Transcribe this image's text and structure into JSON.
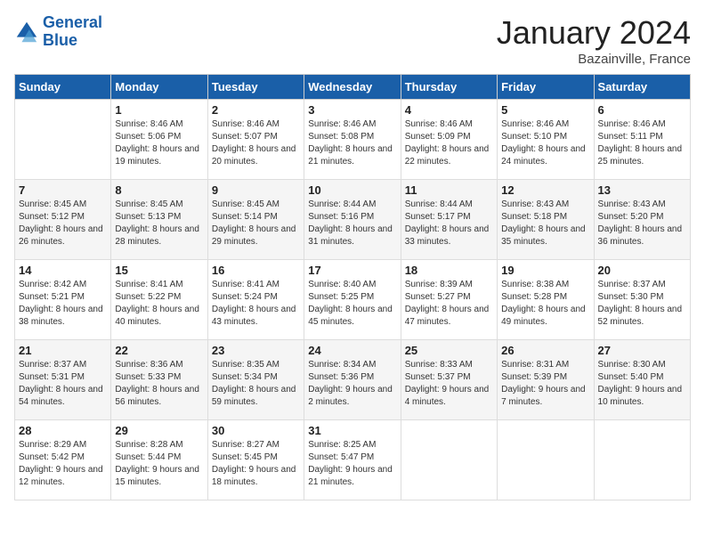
{
  "header": {
    "logo_line1": "General",
    "logo_line2": "Blue",
    "month": "January 2024",
    "location": "Bazainville, France"
  },
  "days_of_week": [
    "Sunday",
    "Monday",
    "Tuesday",
    "Wednesday",
    "Thursday",
    "Friday",
    "Saturday"
  ],
  "weeks": [
    [
      {
        "day": "",
        "sunrise": "",
        "sunset": "",
        "daylight": ""
      },
      {
        "day": "1",
        "sunrise": "Sunrise: 8:46 AM",
        "sunset": "Sunset: 5:06 PM",
        "daylight": "Daylight: 8 hours and 19 minutes."
      },
      {
        "day": "2",
        "sunrise": "Sunrise: 8:46 AM",
        "sunset": "Sunset: 5:07 PM",
        "daylight": "Daylight: 8 hours and 20 minutes."
      },
      {
        "day": "3",
        "sunrise": "Sunrise: 8:46 AM",
        "sunset": "Sunset: 5:08 PM",
        "daylight": "Daylight: 8 hours and 21 minutes."
      },
      {
        "day": "4",
        "sunrise": "Sunrise: 8:46 AM",
        "sunset": "Sunset: 5:09 PM",
        "daylight": "Daylight: 8 hours and 22 minutes."
      },
      {
        "day": "5",
        "sunrise": "Sunrise: 8:46 AM",
        "sunset": "Sunset: 5:10 PM",
        "daylight": "Daylight: 8 hours and 24 minutes."
      },
      {
        "day": "6",
        "sunrise": "Sunrise: 8:46 AM",
        "sunset": "Sunset: 5:11 PM",
        "daylight": "Daylight: 8 hours and 25 minutes."
      }
    ],
    [
      {
        "day": "7",
        "sunrise": "Sunrise: 8:45 AM",
        "sunset": "Sunset: 5:12 PM",
        "daylight": "Daylight: 8 hours and 26 minutes."
      },
      {
        "day": "8",
        "sunrise": "Sunrise: 8:45 AM",
        "sunset": "Sunset: 5:13 PM",
        "daylight": "Daylight: 8 hours and 28 minutes."
      },
      {
        "day": "9",
        "sunrise": "Sunrise: 8:45 AM",
        "sunset": "Sunset: 5:14 PM",
        "daylight": "Daylight: 8 hours and 29 minutes."
      },
      {
        "day": "10",
        "sunrise": "Sunrise: 8:44 AM",
        "sunset": "Sunset: 5:16 PM",
        "daylight": "Daylight: 8 hours and 31 minutes."
      },
      {
        "day": "11",
        "sunrise": "Sunrise: 8:44 AM",
        "sunset": "Sunset: 5:17 PM",
        "daylight": "Daylight: 8 hours and 33 minutes."
      },
      {
        "day": "12",
        "sunrise": "Sunrise: 8:43 AM",
        "sunset": "Sunset: 5:18 PM",
        "daylight": "Daylight: 8 hours and 35 minutes."
      },
      {
        "day": "13",
        "sunrise": "Sunrise: 8:43 AM",
        "sunset": "Sunset: 5:20 PM",
        "daylight": "Daylight: 8 hours and 36 minutes."
      }
    ],
    [
      {
        "day": "14",
        "sunrise": "Sunrise: 8:42 AM",
        "sunset": "Sunset: 5:21 PM",
        "daylight": "Daylight: 8 hours and 38 minutes."
      },
      {
        "day": "15",
        "sunrise": "Sunrise: 8:41 AM",
        "sunset": "Sunset: 5:22 PM",
        "daylight": "Daylight: 8 hours and 40 minutes."
      },
      {
        "day": "16",
        "sunrise": "Sunrise: 8:41 AM",
        "sunset": "Sunset: 5:24 PM",
        "daylight": "Daylight: 8 hours and 43 minutes."
      },
      {
        "day": "17",
        "sunrise": "Sunrise: 8:40 AM",
        "sunset": "Sunset: 5:25 PM",
        "daylight": "Daylight: 8 hours and 45 minutes."
      },
      {
        "day": "18",
        "sunrise": "Sunrise: 8:39 AM",
        "sunset": "Sunset: 5:27 PM",
        "daylight": "Daylight: 8 hours and 47 minutes."
      },
      {
        "day": "19",
        "sunrise": "Sunrise: 8:38 AM",
        "sunset": "Sunset: 5:28 PM",
        "daylight": "Daylight: 8 hours and 49 minutes."
      },
      {
        "day": "20",
        "sunrise": "Sunrise: 8:37 AM",
        "sunset": "Sunset: 5:30 PM",
        "daylight": "Daylight: 8 hours and 52 minutes."
      }
    ],
    [
      {
        "day": "21",
        "sunrise": "Sunrise: 8:37 AM",
        "sunset": "Sunset: 5:31 PM",
        "daylight": "Daylight: 8 hours and 54 minutes."
      },
      {
        "day": "22",
        "sunrise": "Sunrise: 8:36 AM",
        "sunset": "Sunset: 5:33 PM",
        "daylight": "Daylight: 8 hours and 56 minutes."
      },
      {
        "day": "23",
        "sunrise": "Sunrise: 8:35 AM",
        "sunset": "Sunset: 5:34 PM",
        "daylight": "Daylight: 8 hours and 59 minutes."
      },
      {
        "day": "24",
        "sunrise": "Sunrise: 8:34 AM",
        "sunset": "Sunset: 5:36 PM",
        "daylight": "Daylight: 9 hours and 2 minutes."
      },
      {
        "day": "25",
        "sunrise": "Sunrise: 8:33 AM",
        "sunset": "Sunset: 5:37 PM",
        "daylight": "Daylight: 9 hours and 4 minutes."
      },
      {
        "day": "26",
        "sunrise": "Sunrise: 8:31 AM",
        "sunset": "Sunset: 5:39 PM",
        "daylight": "Daylight: 9 hours and 7 minutes."
      },
      {
        "day": "27",
        "sunrise": "Sunrise: 8:30 AM",
        "sunset": "Sunset: 5:40 PM",
        "daylight": "Daylight: 9 hours and 10 minutes."
      }
    ],
    [
      {
        "day": "28",
        "sunrise": "Sunrise: 8:29 AM",
        "sunset": "Sunset: 5:42 PM",
        "daylight": "Daylight: 9 hours and 12 minutes."
      },
      {
        "day": "29",
        "sunrise": "Sunrise: 8:28 AM",
        "sunset": "Sunset: 5:44 PM",
        "daylight": "Daylight: 9 hours and 15 minutes."
      },
      {
        "day": "30",
        "sunrise": "Sunrise: 8:27 AM",
        "sunset": "Sunset: 5:45 PM",
        "daylight": "Daylight: 9 hours and 18 minutes."
      },
      {
        "day": "31",
        "sunrise": "Sunrise: 8:25 AM",
        "sunset": "Sunset: 5:47 PM",
        "daylight": "Daylight: 9 hours and 21 minutes."
      },
      {
        "day": "",
        "sunrise": "",
        "sunset": "",
        "daylight": ""
      },
      {
        "day": "",
        "sunrise": "",
        "sunset": "",
        "daylight": ""
      },
      {
        "day": "",
        "sunrise": "",
        "sunset": "",
        "daylight": ""
      }
    ]
  ]
}
